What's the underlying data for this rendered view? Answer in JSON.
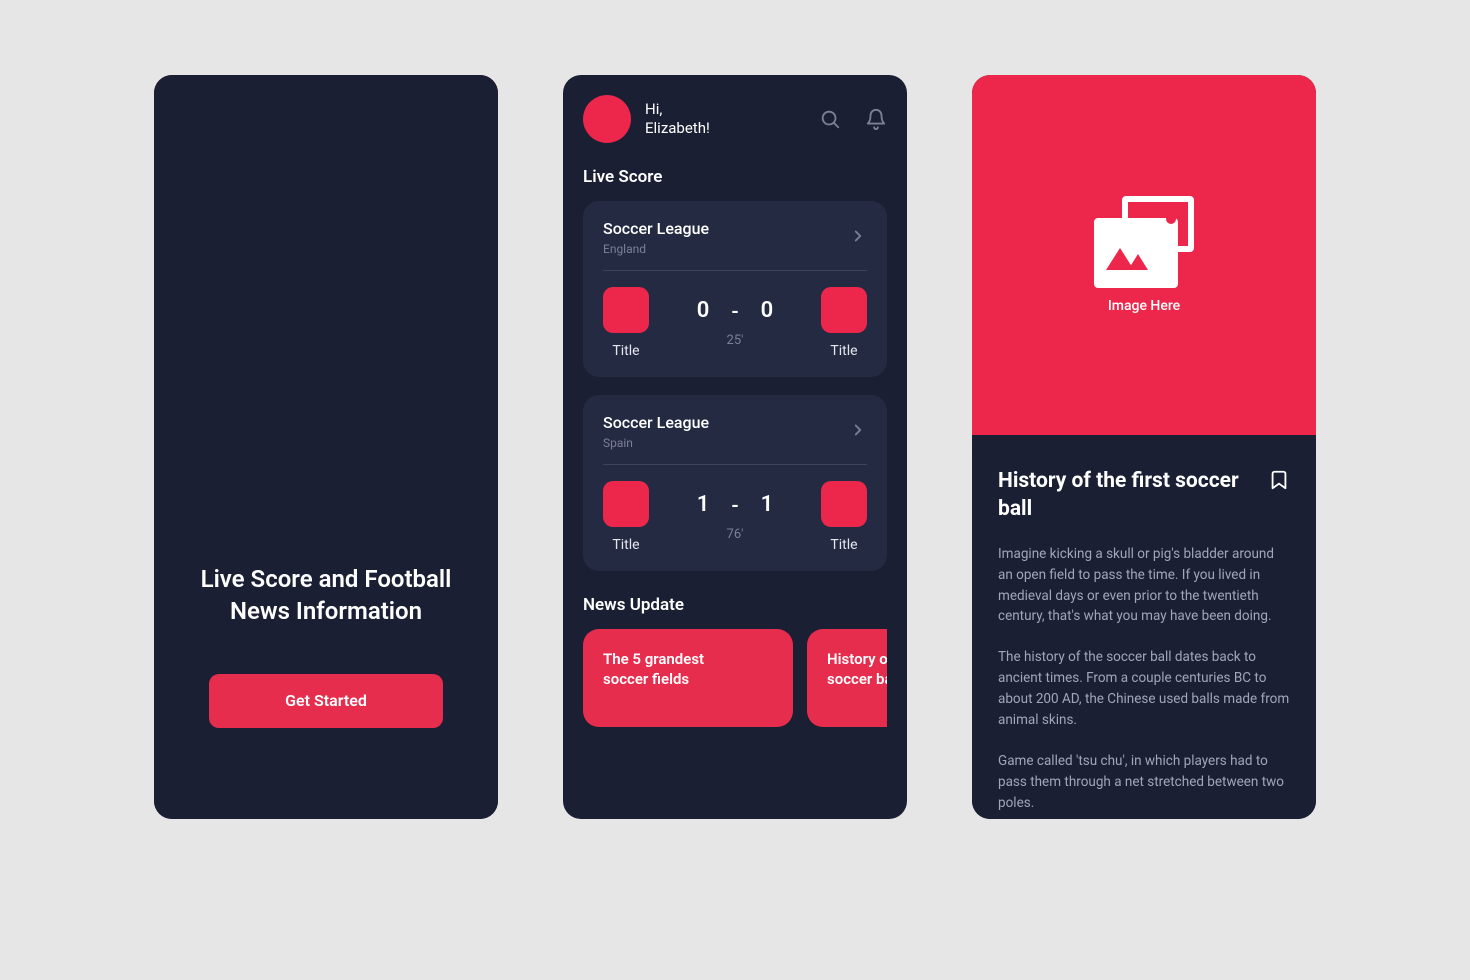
{
  "accent": "#ec274b",
  "image_placeholder_label": "Image Here",
  "onboarding": {
    "headline": "Live Score and Football News Information",
    "cta": "Get Started"
  },
  "home": {
    "greeting_hi": "Hi,",
    "greeting_name": "Elizabeth!",
    "live_section": "Live Score",
    "news_section": "News Update",
    "matches": [
      {
        "league": "Soccer League",
        "country": "England",
        "home_name": "Title",
        "away_name": "Title",
        "home_score": "0",
        "away_score": "0",
        "minute": "25'"
      },
      {
        "league": "Soccer League",
        "country": "Spain",
        "home_name": "Title",
        "away_name": "Title",
        "home_score": "1",
        "away_score": "1",
        "minute": "76'"
      }
    ],
    "news": [
      {
        "title": "The 5 grandest soccer fields"
      },
      {
        "title": "History of the first soccer ball"
      }
    ]
  },
  "article": {
    "title": "History of the first soccer ball",
    "p1": "Imagine kicking a skull or pig's bladder around an open field to pass the time. If you lived in medieval days or even prior to the twentieth century, that's what you may have been doing.",
    "p2": "The history of the soccer ball dates back to ancient times. From a couple centuries BC to about 200 AD, the Chinese used balls made from animal skins.",
    "p3": "Game called 'tsu chu', in which players had to pass them through a net stretched between two poles."
  }
}
